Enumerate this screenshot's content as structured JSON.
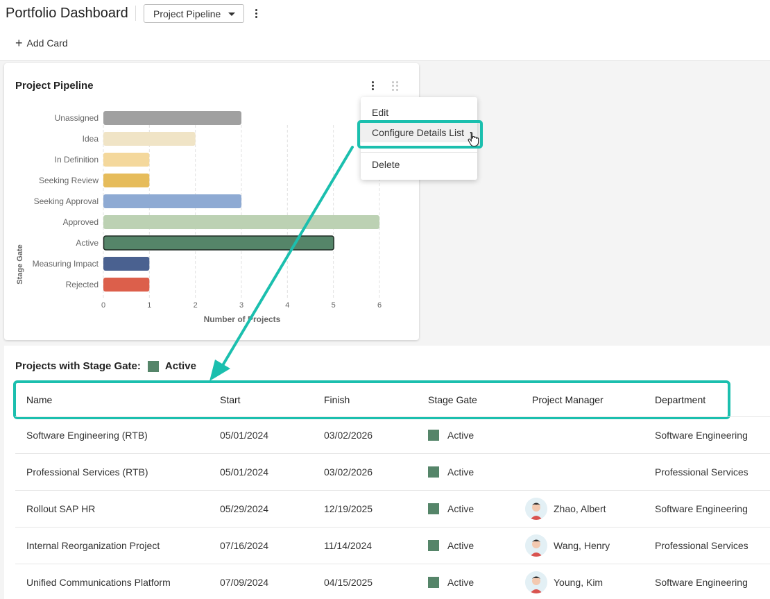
{
  "header": {
    "title": "Portfolio Dashboard",
    "view_selector": "Project Pipeline",
    "add_card_label": "Add Card"
  },
  "chart_card": {
    "title": "Project Pipeline",
    "menu": {
      "items": [
        "Edit",
        "Configure Details List",
        "Delete"
      ],
      "hovered": "Configure Details List"
    }
  },
  "chart_data": {
    "type": "bar",
    "orientation": "horizontal",
    "categories": [
      "Unassigned",
      "Idea",
      "In Definition",
      "Seeking Review",
      "Seeking Approval",
      "Approved",
      "Active",
      "Measuring Impact",
      "Rejected"
    ],
    "values": [
      3,
      2,
      1,
      1,
      3,
      6,
      5,
      1,
      1
    ],
    "colors": [
      "#a0a0a0",
      "#f0e4c6",
      "#f4d89c",
      "#e6bc5b",
      "#8eaad3",
      "#bcd1b3",
      "#558569",
      "#4a6190",
      "#dc5f4b"
    ],
    "selected": "Active",
    "xlabel": "Number of Projects",
    "ylabel": "Stage Gate",
    "xlim": [
      0,
      6
    ],
    "xticks": [
      "0",
      "1",
      "2",
      "3",
      "4",
      "5",
      "6"
    ],
    "grid": true
  },
  "details": {
    "title_prefix": "Projects with Stage Gate:",
    "filter_value": "Active",
    "filter_color": "#558569",
    "columns": [
      "Name",
      "Start",
      "Finish",
      "Stage Gate",
      "Project Manager",
      "Department"
    ],
    "rows": [
      {
        "name": "Software Engineering (RTB)",
        "start": "05/01/2024",
        "finish": "03/02/2026",
        "gate": "Active",
        "manager": "",
        "department": "Software Engineering"
      },
      {
        "name": "Professional Services (RTB)",
        "start": "05/01/2024",
        "finish": "03/02/2026",
        "gate": "Active",
        "manager": "",
        "department": "Professional Services"
      },
      {
        "name": "Rollout SAP HR",
        "start": "05/29/2024",
        "finish": "12/19/2025",
        "gate": "Active",
        "manager": "Zhao, Albert",
        "department": "Software Engineering"
      },
      {
        "name": "Internal Reorganization Project",
        "start": "07/16/2024",
        "finish": "11/14/2024",
        "gate": "Active",
        "manager": "Wang, Henry",
        "department": "Professional Services"
      },
      {
        "name": "Unified Communications Platform",
        "start": "07/09/2024",
        "finish": "04/15/2025",
        "gate": "Active",
        "manager": "Young, Kim",
        "department": "Software Engineering"
      }
    ]
  }
}
